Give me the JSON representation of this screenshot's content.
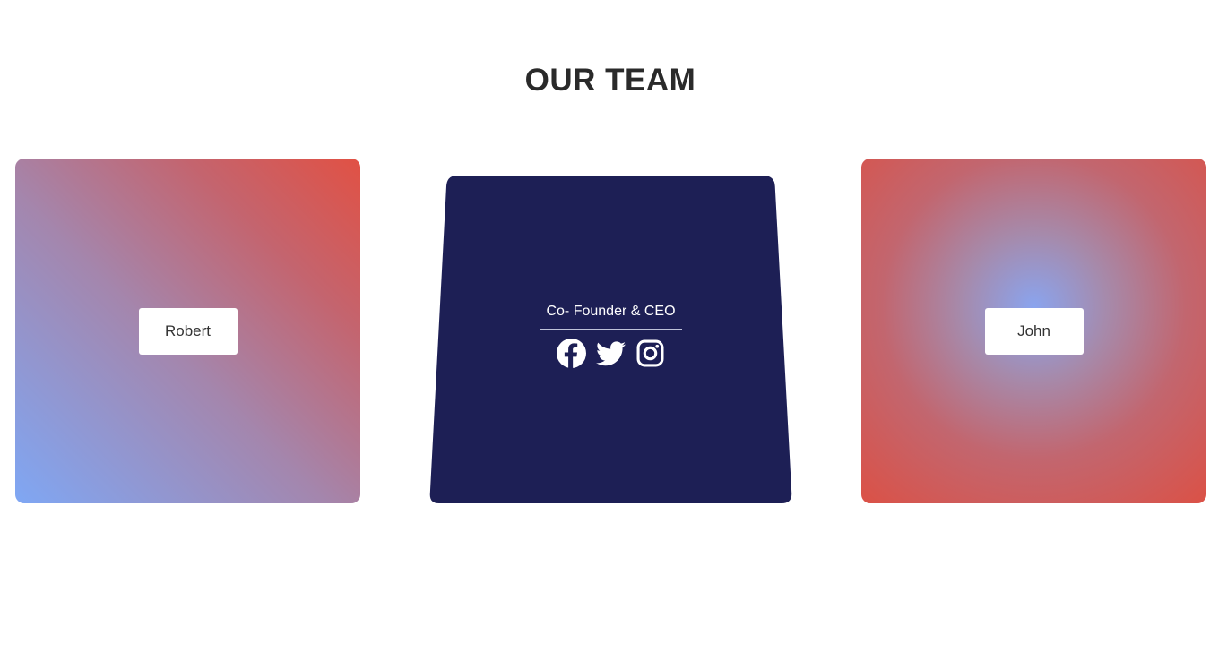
{
  "page": {
    "title": "OUR TEAM"
  },
  "cards": {
    "left": {
      "name": "Robert"
    },
    "center": {
      "role": "Co- Founder & CEO",
      "bg_color": "#1d1f55",
      "social": [
        "facebook-icon",
        "twitter-icon",
        "instagram-icon"
      ]
    },
    "right": {
      "name": "John"
    }
  },
  "colors": {
    "title": "#2a2a2a",
    "accent_red": "#e15144",
    "accent_blue": "#7fa7f4",
    "card_navy": "#1d1f55"
  }
}
